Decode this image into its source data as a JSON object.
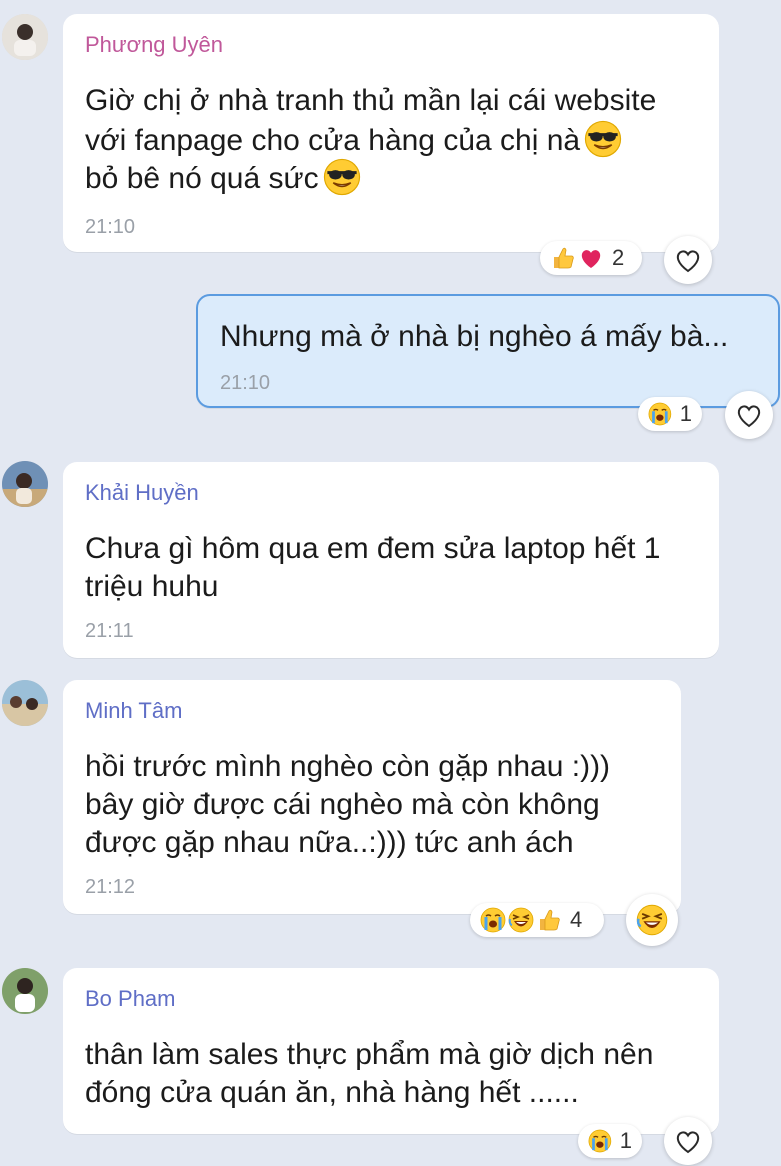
{
  "colors": {
    "background": "#e3e8f2",
    "bubble": "#ffffff",
    "own_bubble": "#dbebfb",
    "own_border": "#5b9be0",
    "sender_name": "#5f6ec6",
    "sender_name_pink": "#c0589a",
    "time": "#9aa0a8"
  },
  "messages": [
    {
      "sender": "Phương Uyên",
      "lines": [
        "Giờ chị ở nhà tranh thủ mần lại cái website",
        "với fanpage cho cửa hàng của chị nà",
        "bỏ bê nó quá sức"
      ],
      "inline_emojis": [
        "smiling-face-with-sunglasses",
        "smiling-face-with-sunglasses"
      ],
      "time": "21:10",
      "reactions": [
        "thumbs-up",
        "red-heart"
      ],
      "reaction_count": "2",
      "react_button": "heart-outline-icon"
    },
    {
      "sender": "",
      "own": true,
      "lines": [
        "Nhưng mà ở nhà bị nghèo á mấy bà..."
      ],
      "time": "21:10",
      "reactions": [
        "loudly-crying-face"
      ],
      "reaction_count": "1",
      "react_button": "heart-outline-icon"
    },
    {
      "sender": "Khải Huyền",
      "lines": [
        "Chưa gì hôm qua em đem sửa laptop hết 1",
        "triệu huhu"
      ],
      "time": "21:11"
    },
    {
      "sender": "Minh Tâm",
      "lines": [
        "hồi trước mình nghèo còn gặp nhau :)))",
        "bây giờ được cái nghèo mà còn không",
        "được gặp nhau nữa..:))) tức anh ách"
      ],
      "time": "21:12",
      "reactions": [
        "loudly-crying-face",
        "laughing-face",
        "thumbs-up"
      ],
      "reaction_count": "4",
      "react_button": "laughing-face-icon"
    },
    {
      "sender": "Bo Pham",
      "lines": [
        "thân làm sales thực phẩm mà giờ dịch nên",
        "đóng cửa quán ăn, nhà hàng hết ......"
      ],
      "reactions": [
        "loudly-crying-face"
      ],
      "reaction_count": "1",
      "react_button": "heart-outline-icon"
    }
  ]
}
